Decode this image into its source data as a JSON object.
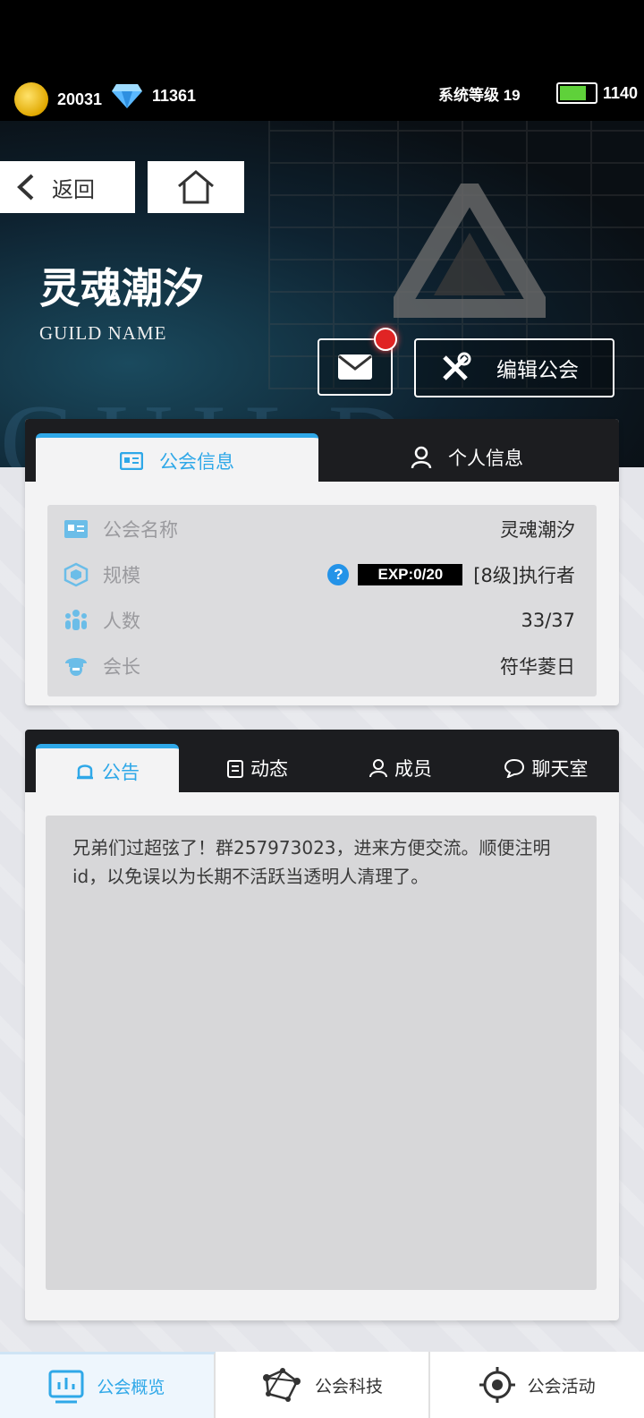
{
  "status": {
    "gold": "20031",
    "diamond": "11361",
    "system_level_label": "系统等级 19",
    "energy": "1140"
  },
  "header": {
    "back_label": "返回",
    "guild_name": "灵魂潮汐",
    "guild_name_sub": "GUILD NAME",
    "edit_label": "编辑公会"
  },
  "info_panel": {
    "tabs": [
      {
        "label": "公会信息",
        "icon": "id-card-icon",
        "active": true
      },
      {
        "label": "个人信息",
        "icon": "person-icon",
        "active": false
      }
    ],
    "rows": [
      {
        "label": "公会名称",
        "icon": "id-card-icon",
        "value": "灵魂潮汐"
      },
      {
        "label": "规模",
        "icon": "cube-icon",
        "exp": "EXP:0/20",
        "value": "[8级]执行者"
      },
      {
        "label": "人数",
        "icon": "people-icon",
        "value": "33/37"
      },
      {
        "label": "会长",
        "icon": "leader-icon",
        "value": "符华菱日"
      }
    ]
  },
  "notice_panel": {
    "tabs": [
      {
        "label": "公告",
        "icon": "bell-icon",
        "active": true
      },
      {
        "label": "动态",
        "icon": "clipboard-icon",
        "active": false
      },
      {
        "label": "成员",
        "icon": "person-icon",
        "active": false
      },
      {
        "label": "聊天室",
        "icon": "chat-icon",
        "active": false
      }
    ],
    "text": "兄弟们过超弦了！群257973023，进来方便交流。顺便注明id，以免误以为长期不活跃当透明人清理了。"
  },
  "bottom_nav": [
    {
      "label": "公会概览",
      "icon": "chart-icon",
      "active": true
    },
    {
      "label": "公会科技",
      "icon": "network-icon",
      "active": false
    },
    {
      "label": "公会活动",
      "icon": "target-icon",
      "active": false
    }
  ],
  "colors": {
    "accent": "#2fa8e8",
    "badge": "#e02424",
    "panel_head": "#1c1d20"
  }
}
